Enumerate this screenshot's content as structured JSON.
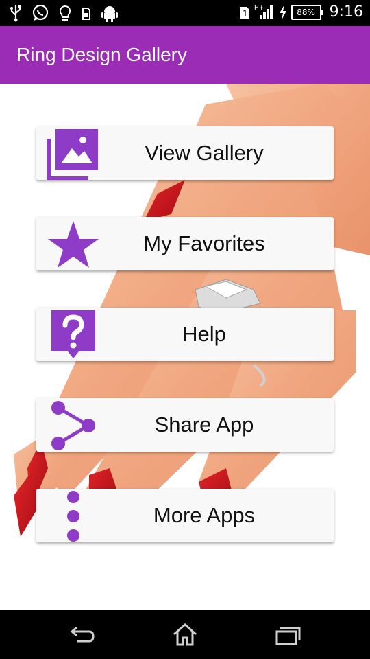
{
  "status_bar": {
    "time": "9:16",
    "battery": "88%",
    "icons": [
      "usb-icon",
      "whatsapp-icon",
      "lightbulb-icon",
      "sim-icon",
      "android-icon",
      "sim1-icon",
      "signal-icon",
      "charging-icon"
    ]
  },
  "app_bar": {
    "title": "Ring Design Gallery"
  },
  "menu": {
    "items": [
      {
        "label": "View Gallery",
        "icon": "gallery-icon"
      },
      {
        "label": "My Favorites",
        "icon": "star-icon"
      },
      {
        "label": "Help",
        "icon": "help-icon"
      },
      {
        "label": "Share App",
        "icon": "share-icon"
      },
      {
        "label": "More Apps",
        "icon": "more-vert-icon"
      }
    ]
  },
  "colors": {
    "accent": "#9a2cb6",
    "icon": "#8e3cc8",
    "button_bg": "#f8f8f8"
  },
  "nav_bar": {
    "buttons": [
      "back-icon",
      "home-icon",
      "recents-icon"
    ]
  }
}
